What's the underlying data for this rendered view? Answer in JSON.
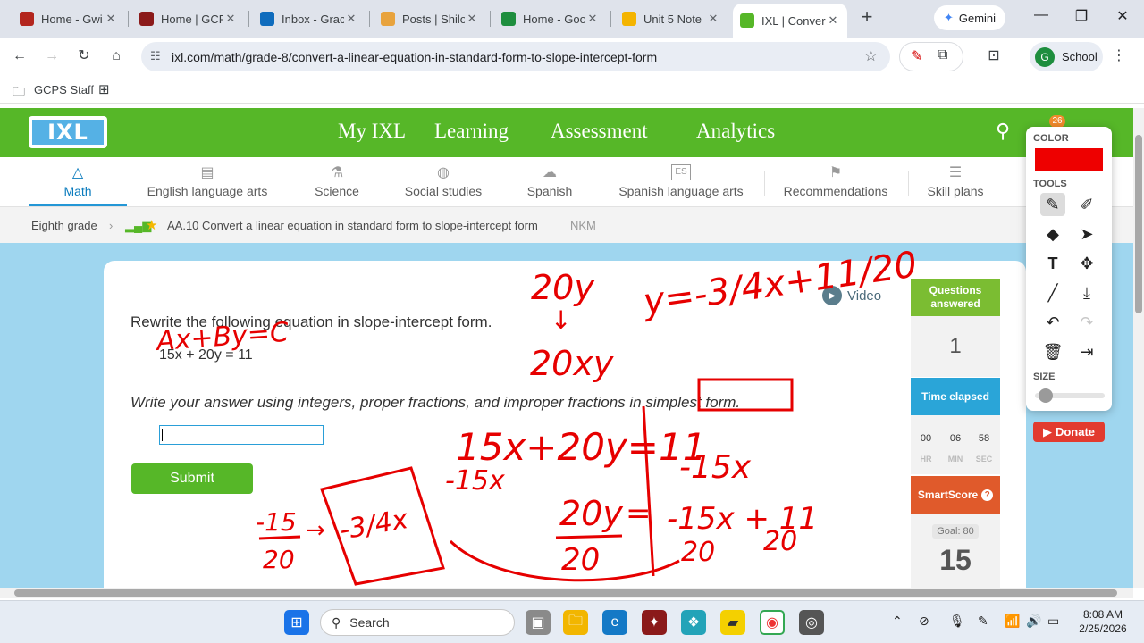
{
  "browser": {
    "tabs": [
      {
        "title": "Home - Gwi",
        "favicon_color": "#b3261e"
      },
      {
        "title": "Home | GCP",
        "favicon_color": "#8b1a1a"
      },
      {
        "title": "Inbox - Grac",
        "favicon_color": "#0f6cbd"
      },
      {
        "title": "Posts | Shilo",
        "favicon_color": "#e8a33d"
      },
      {
        "title": "Home - Goo",
        "favicon_color": "#1e8e3e"
      },
      {
        "title": "Unit 5 Note",
        "favicon_color": "#f4b400"
      },
      {
        "title": "IXL | Conver",
        "favicon_color": "#56b728",
        "active": true
      }
    ],
    "new_tab": "+",
    "gemini_label": "Gemini",
    "url": "ixl.com/math/grade-8/convert-a-linear-equation-in-standard-form-to-slope-intercept-form",
    "profile_initial": "G",
    "profile_label": "School",
    "bookmark": "GCPS Staff"
  },
  "ixl": {
    "logo": "IXL",
    "nav": [
      "My IXL",
      "Learning",
      "Assessment",
      "Analytics"
    ],
    "badge_count": "26",
    "subjects": [
      {
        "label": "Math",
        "icon": "△"
      },
      {
        "label": "English language arts",
        "icon": "▤"
      },
      {
        "label": "Science",
        "icon": "⚗"
      },
      {
        "label": "Social studies",
        "icon": "◍"
      },
      {
        "label": "Spanish",
        "icon": "☁"
      },
      {
        "label": "Spanish language arts",
        "icon": "ES"
      },
      {
        "label": "Recommendations",
        "icon": "⚑"
      },
      {
        "label": "Skill plans",
        "icon": "☰"
      }
    ],
    "breadcrumb": {
      "grade": "Eighth grade",
      "skill": "AA.10 Convert a linear equation in standard form to slope-intercept form",
      "code": "NKM"
    },
    "problem": {
      "question": "Rewrite the following equation in slope-intercept form.",
      "equation": "15x + 20y = 11",
      "instructions": "Write your answer using integers, proper fractions, and improper fractions in simplest form.",
      "submit": "Submit",
      "video": "Video"
    },
    "stats": {
      "questions_answered_label": "Questions answered",
      "questions_answered": "1",
      "time_elapsed_label": "Time elapsed",
      "timer": {
        "hr": "00",
        "min": "06",
        "sec": "58"
      },
      "timer_labels": {
        "hr": "HR",
        "min": "MIN",
        "sec": "SEC"
      },
      "smartscore_label": "SmartScore",
      "goal": "Goal: 80",
      "smartscore": "15"
    },
    "donate": "Donate"
  },
  "palette": {
    "color_label": "COLOR",
    "color": "#ee0000",
    "tools_label": "TOOLS",
    "size_label": "SIZE",
    "tools": [
      "pen-icon",
      "highlighter-icon",
      "eraser-icon",
      "pointer-icon",
      "text-icon",
      "move-icon",
      "line-icon",
      "save-icon",
      "undo-icon",
      "redo-icon",
      "trash-icon",
      "exit-icon"
    ]
  },
  "annotations": {
    "standard_form": "Ax+By=C",
    "twenty_y": "20y",
    "twenty_x_y": "20xy",
    "result": "y=-3/4x+11/20",
    "work_top": "15x+20y=11",
    "minus_15x_left": "-15x",
    "minus_15x_right": "-15x",
    "frac_left_num": "-15",
    "frac_left_den": "20",
    "frac_box": "-3/4x",
    "frac_mid_num": "20y",
    "frac_mid_den": "20",
    "frac_right": "-15x + 11",
    "frac_right_den": "20"
  },
  "taskbar": {
    "search": "Search",
    "time": "8:08 AM",
    "date": "2/25/2026"
  }
}
